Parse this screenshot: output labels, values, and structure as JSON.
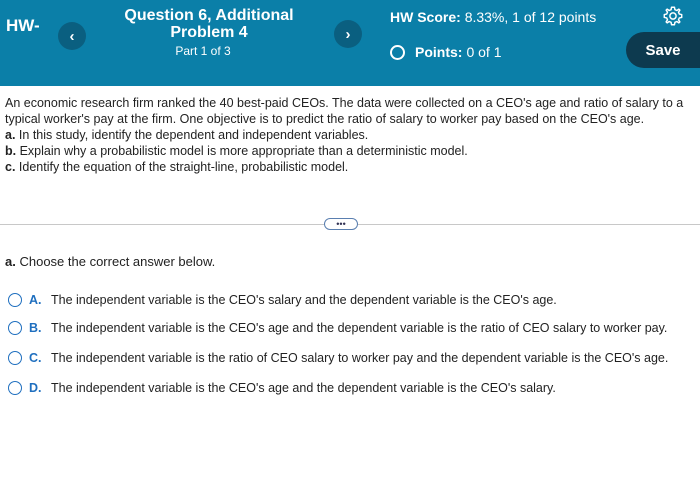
{
  "header": {
    "hw_label": "HW-",
    "question_title": "Question 6, Additional Problem 4",
    "part": "Part 1 of 3",
    "score_label": "HW Score:",
    "score_value": "8.33%, 1 of 12 points",
    "points_label": "Points:",
    "points_value": "0 of 1",
    "save_label": "Save",
    "prev_glyph": "‹",
    "next_glyph": "›",
    "icons": [
      "chevron-left-icon",
      "chevron-right-icon",
      "gear-icon",
      "radio-ring-icon"
    ],
    "colors": {
      "header_bg": "#0b7fa8",
      "save_bg": "#0d3a4f",
      "accent": "#1f6fbf"
    }
  },
  "problem": {
    "intro": "An economic research firm ranked the 40 best-paid CEOs. The data were collected on a CEO's age and ratio of salary to a typical worker's pay at the firm. One objective is to predict the ratio of salary to worker pay based on the CEO's age.",
    "parts": [
      {
        "label": "a.",
        "text": "In this study, identify the dependent and independent variables."
      },
      {
        "label": "b.",
        "text": "Explain why a probabilistic model is more appropriate than a deterministic model."
      },
      {
        "label": "c.",
        "text": "Identify the equation of the straight-line, probabilistic model."
      }
    ]
  },
  "expand_label": "•••",
  "question": {
    "label": "a.",
    "prompt": "Choose the correct answer below.",
    "options": [
      {
        "letter": "A.",
        "text": "The independent variable is the CEO's salary and the dependent variable is the CEO's age."
      },
      {
        "letter": "B.",
        "text": "The independent variable is the CEO's age and the dependent variable is the ratio of CEO salary to worker pay."
      },
      {
        "letter": "C.",
        "text": "The independent variable is the ratio of CEO salary to worker pay and the dependent variable is the CEO's age."
      },
      {
        "letter": "D.",
        "text": "The independent variable is the CEO's age and the dependent variable is the CEO's salary."
      }
    ]
  }
}
